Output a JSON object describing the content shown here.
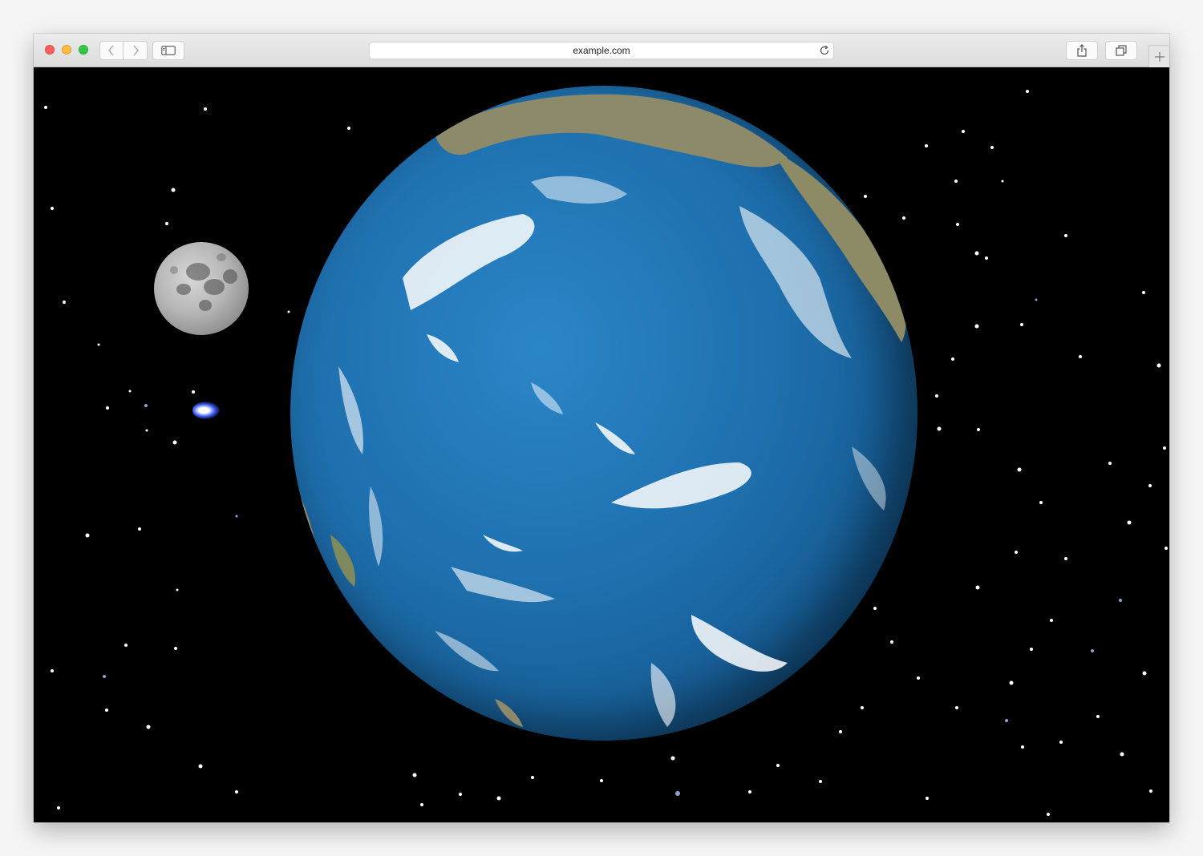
{
  "browser": {
    "url": "example.com",
    "icons": {
      "close": "close-icon",
      "minimize": "minimize-icon",
      "maximize": "maximize-icon",
      "back": "chevron-left-icon",
      "forward": "chevron-right-icon",
      "sidebar": "sidebar-icon",
      "reload": "reload-icon",
      "share": "share-icon",
      "tabs": "tabs-icon",
      "new_tab": "plus-icon"
    }
  },
  "scene": {
    "background": "#000000",
    "objects": [
      "earth",
      "moon",
      "blue-star"
    ],
    "colors": {
      "ocean": "#1e6fad",
      "land": "#8c8a6a",
      "clouds": "#ffffff",
      "moon": "#b5b5b5",
      "blue_star": "#3d5cff"
    }
  }
}
